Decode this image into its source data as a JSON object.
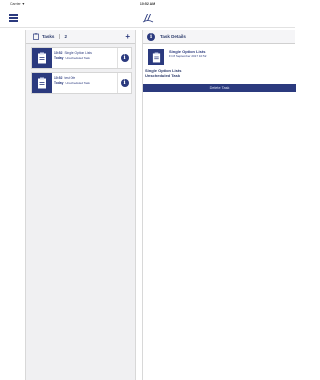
{
  "status_bar": {
    "carrier": "Carrier ▼",
    "time": "10:52 AM"
  },
  "nav": {
    "menu_icon": "hamburger-menu-icon",
    "logo_icon": "app-logo-icon"
  },
  "tasks_panel": {
    "title": "Tasks",
    "count": "2",
    "add_label": "+",
    "items": [
      {
        "time": "10:52",
        "day": "Today",
        "title": "Single Option Lists",
        "subtitle": "Unscheduled Task"
      },
      {
        "time": "10:52",
        "day": "Today",
        "title": "test 0fe",
        "subtitle": "Unscheduled Task"
      }
    ]
  },
  "detail_panel": {
    "title": "Task Details",
    "task_title": "Single Option Lists",
    "task_date": "Fri 8 September 2017 10:52",
    "body_line1": "Single Option Lists",
    "body_line2": "Unscheduled Task",
    "delete_label": "Delete Task"
  },
  "colors": {
    "primary": "#2b3a7e",
    "panel_bg": "#f0f0f2",
    "text": "#2b3a6b"
  }
}
